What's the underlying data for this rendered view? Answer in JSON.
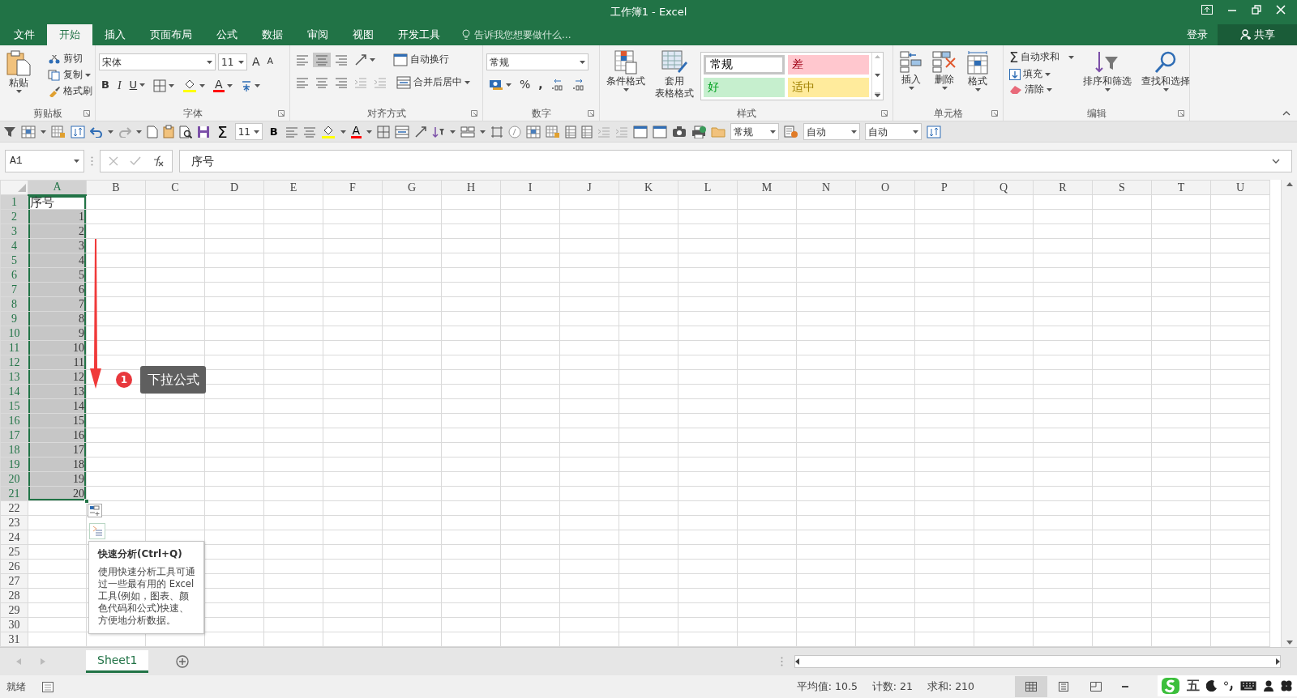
{
  "window": {
    "title": "工作簿1 - Excel"
  },
  "menu_tabs": [
    {
      "label": "文件",
      "selected": false
    },
    {
      "label": "开始",
      "selected": true
    },
    {
      "label": "插入",
      "selected": false
    },
    {
      "label": "页面布局",
      "selected": false
    },
    {
      "label": "公式",
      "selected": false
    },
    {
      "label": "数据",
      "selected": false
    },
    {
      "label": "审阅",
      "selected": false
    },
    {
      "label": "视图",
      "selected": false
    },
    {
      "label": "开发工具",
      "selected": false
    }
  ],
  "tell_me": {
    "placeholder": "告诉我您想要做什么..."
  },
  "account": {
    "sign_in": "登录",
    "share": "共享"
  },
  "ribbon": {
    "clipboard": {
      "paste": "粘贴",
      "cut": "剪切",
      "copy": "复制",
      "format_painter": "格式刷",
      "label": "剪贴板"
    },
    "font": {
      "font_name": "宋体",
      "font_size": "11",
      "grow": "A",
      "shrink": "A",
      "bold": "B",
      "italic": "I",
      "underline": "U",
      "font_color": "A",
      "label": "字体"
    },
    "alignment": {
      "wrap_text": "自动换行",
      "merge_center": "合并后居中",
      "label": "对齐方式"
    },
    "number": {
      "format": "常规",
      "percent": "%",
      "comma": ",",
      "label": "数字"
    },
    "styles": {
      "conditional": "条件格式",
      "format_table": [
        "套用",
        "表格格式"
      ],
      "cell_styles": [
        {
          "label": "常规",
          "color": "#ffffff",
          "selected": true
        },
        {
          "label": "差",
          "color": "#ffc7ce",
          "selected": false
        },
        {
          "label": "好",
          "color": "#c6efce",
          "selected": false
        },
        {
          "label": "适中",
          "color": "#ffeb9c",
          "selected": false
        }
      ],
      "label": "样式"
    },
    "cells": {
      "insert": "插入",
      "delete": "删除",
      "format": "格式",
      "label": "单元格"
    },
    "editing": {
      "autosum_symbol": "Σ",
      "autosum": "自动求和",
      "fill": "填充",
      "clear": "清除",
      "sort_filter": "排序和筛选",
      "find_select": "查找和选择",
      "label": "编辑"
    }
  },
  "quick_toolbar": {
    "sum": "Σ",
    "font_size": "11",
    "bold": "B",
    "font_color": "A",
    "number_format": "常规",
    "fill_color": "自动",
    "line_color": "自动"
  },
  "formula_bar": {
    "name_box": "A1",
    "value": "序号"
  },
  "sheet": {
    "columns": [
      {
        "label": "A",
        "selected": true
      },
      {
        "label": "B",
        "selected": false
      },
      {
        "label": "C",
        "selected": false
      },
      {
        "label": "D",
        "selected": false
      },
      {
        "label": "E",
        "selected": false
      },
      {
        "label": "F",
        "selected": false
      },
      {
        "label": "G",
        "selected": false
      },
      {
        "label": "H",
        "selected": false
      },
      {
        "label": "I",
        "selected": false
      },
      {
        "label": "J",
        "selected": false
      },
      {
        "label": "K",
        "selected": false
      },
      {
        "label": "L",
        "selected": false
      },
      {
        "label": "M",
        "selected": false
      },
      {
        "label": "N",
        "selected": false
      },
      {
        "label": "O",
        "selected": false
      },
      {
        "label": "P",
        "selected": false
      },
      {
        "label": "Q",
        "selected": false
      },
      {
        "label": "R",
        "selected": false
      },
      {
        "label": "S",
        "selected": false
      },
      {
        "label": "T",
        "selected": false
      },
      {
        "label": "U",
        "selected": false
      }
    ],
    "rows": [
      {
        "header": "1",
        "selected": true,
        "cells": [
          {
            "value": "序号",
            "kind": "text",
            "active": true
          }
        ]
      },
      {
        "header": "2",
        "selected": true,
        "cells": [
          {
            "value": "1",
            "kind": "number",
            "active": false
          }
        ]
      },
      {
        "header": "3",
        "selected": true,
        "cells": [
          {
            "value": "2",
            "kind": "number",
            "active": false
          }
        ]
      },
      {
        "header": "4",
        "selected": true,
        "cells": [
          {
            "value": "3",
            "kind": "number",
            "active": false
          }
        ]
      },
      {
        "header": "5",
        "selected": true,
        "cells": [
          {
            "value": "4",
            "kind": "number",
            "active": false
          }
        ]
      },
      {
        "header": "6",
        "selected": true,
        "cells": [
          {
            "value": "5",
            "kind": "number",
            "active": false
          }
        ]
      },
      {
        "header": "7",
        "selected": true,
        "cells": [
          {
            "value": "6",
            "kind": "number",
            "active": false
          }
        ]
      },
      {
        "header": "8",
        "selected": true,
        "cells": [
          {
            "value": "7",
            "kind": "number",
            "active": false
          }
        ]
      },
      {
        "header": "9",
        "selected": true,
        "cells": [
          {
            "value": "8",
            "kind": "number",
            "active": false
          }
        ]
      },
      {
        "header": "10",
        "selected": true,
        "cells": [
          {
            "value": "9",
            "kind": "number",
            "active": false
          }
        ]
      },
      {
        "header": "11",
        "selected": true,
        "cells": [
          {
            "value": "10",
            "kind": "number",
            "active": false
          }
        ]
      },
      {
        "header": "12",
        "selected": true,
        "cells": [
          {
            "value": "11",
            "kind": "number",
            "active": false
          }
        ]
      },
      {
        "header": "13",
        "selected": true,
        "cells": [
          {
            "value": "12",
            "kind": "number",
            "active": false
          }
        ]
      },
      {
        "header": "14",
        "selected": true,
        "cells": [
          {
            "value": "13",
            "kind": "number",
            "active": false
          }
        ]
      },
      {
        "header": "15",
        "selected": true,
        "cells": [
          {
            "value": "14",
            "kind": "number",
            "active": false
          }
        ]
      },
      {
        "header": "16",
        "selected": true,
        "cells": [
          {
            "value": "15",
            "kind": "number",
            "active": false
          }
        ]
      },
      {
        "header": "17",
        "selected": true,
        "cells": [
          {
            "value": "16",
            "kind": "number",
            "active": false
          }
        ]
      },
      {
        "header": "18",
        "selected": true,
        "cells": [
          {
            "value": "17",
            "kind": "number",
            "active": false
          }
        ]
      },
      {
        "header": "19",
        "selected": true,
        "cells": [
          {
            "value": "18",
            "kind": "number",
            "active": false
          }
        ]
      },
      {
        "header": "20",
        "selected": true,
        "cells": [
          {
            "value": "19",
            "kind": "number",
            "active": false
          }
        ]
      },
      {
        "header": "21",
        "selected": true,
        "cells": [
          {
            "value": "20",
            "kind": "number",
            "active": false
          }
        ]
      },
      {
        "header": "22",
        "selected": false
      },
      {
        "header": "23",
        "selected": false
      },
      {
        "header": "24",
        "selected": false
      },
      {
        "header": "25",
        "selected": false
      },
      {
        "header": "26",
        "selected": false
      },
      {
        "header": "27",
        "selected": false
      },
      {
        "header": "28",
        "selected": false
      },
      {
        "header": "29",
        "selected": false
      },
      {
        "header": "30",
        "selected": false
      },
      {
        "header": "31",
        "selected": false
      }
    ]
  },
  "annotation": {
    "step": "1",
    "label": "下拉公式"
  },
  "quick_analysis": {
    "title": "快速分析(Ctrl+Q)",
    "text": "使用快速分析工具可通过一些最有用的 Excel 工具(例如，图表、颜色代码和公式)快速、方便地分析数据。"
  },
  "sheet_tabs": [
    {
      "label": "Sheet1",
      "selected": true
    }
  ],
  "status_bar": {
    "ready": "就绪",
    "average": "平均值: 10.5",
    "count": "计数: 21",
    "sum": "求和: 210"
  },
  "view_buttons": [
    {
      "selected": true
    },
    {
      "selected": false
    },
    {
      "selected": false
    }
  ],
  "ime": {
    "mode": "五"
  }
}
